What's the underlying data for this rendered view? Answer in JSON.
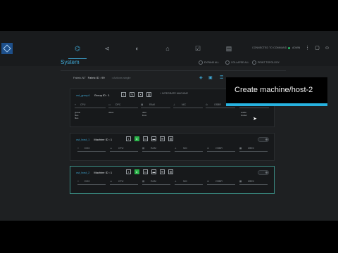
{
  "app": {
    "logo_icon": "diamond-logo-icon",
    "accent": "#3fa9d6",
    "selected_border": "#3b8f86"
  },
  "topnav": [
    "network-icon",
    "share-icon",
    "contrast-icon",
    "home-icon",
    "checklist-icon",
    "clipboard-icon"
  ],
  "status": {
    "label": "CONNECTED TO COMMAND",
    "state_color": "#27c36a"
  },
  "user": {
    "name": "ADMIN"
  },
  "page": {
    "title": "System",
    "actions": [
      "EXPAND ALL",
      "COLLAPSE ALL",
      "PRINT TOPOLOGY"
    ]
  },
  "breadcrumb": {
    "name": "Fabric-N7",
    "id_label": "Fabric ID : 99",
    "hint": "• Actions single"
  },
  "group": {
    "name": "cst_group1",
    "id_label": "Group ID : 1",
    "add_label": "+ INTEGRATE MACHINE",
    "params": [
      "CPU",
      "DPC",
      "RAM",
      "NIC",
      "OSBR"
    ],
    "values": [
      "global\nfiles\nfiles",
      "data1",
      "data\nlinux",
      "",
      "",
      "stable\ncluster"
    ]
  },
  "hosts": [
    {
      "name": "cst_host_1",
      "id_label": "Machine ID : 1",
      "params": [
        "DOC",
        "CPU",
        "RAM",
        "NIC",
        "OSBR",
        "MEDI"
      ]
    },
    {
      "name": "cst_host_2",
      "id_label": "Machine ID : 1",
      "params": [
        "DOC",
        "CPU",
        "RAM",
        "NIC",
        "OSBR",
        "MEDI"
      ]
    }
  ],
  "tooltip": {
    "text": "Create machine/host-2",
    "bar_color": "#27b2e0"
  }
}
